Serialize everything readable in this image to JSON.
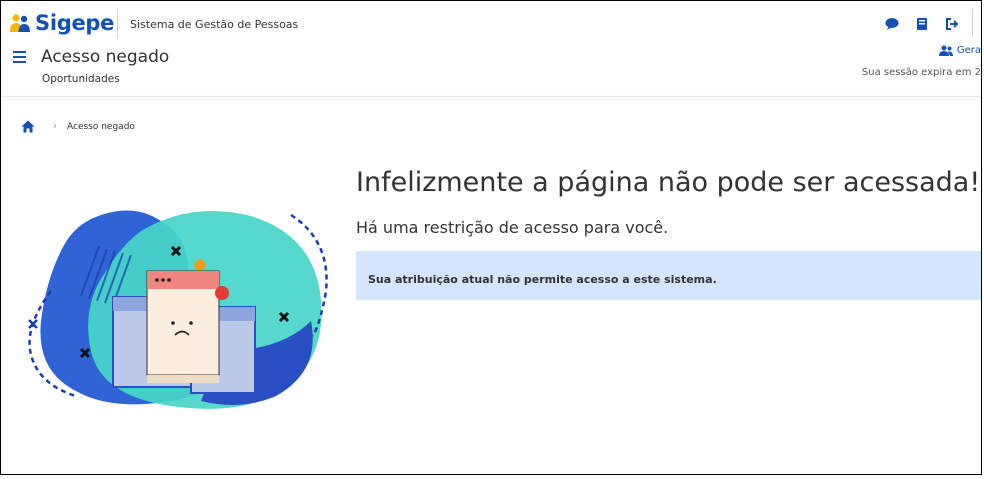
{
  "header": {
    "logo_text": "Sigepe",
    "system_name": "Sistema de Gestão de Pessoas",
    "icons": [
      "chat-icon",
      "book-icon",
      "logout-icon"
    ]
  },
  "title_bar": {
    "menu_icon": "hamburger-menu-icon",
    "title": "Acesso negado",
    "subtitle": "Oportunidades",
    "user_link": "Gera",
    "session_text": "Sua sessão expira em 2"
  },
  "breadcrumb": {
    "home_icon": "home-icon",
    "current": "Acesso negado"
  },
  "message": {
    "headline": "Infelizmente a página não pode ser acessada!",
    "subline": "Há uma restrição de acesso para você.",
    "alert": "Sua atribuição atual não permite acesso a este sistema."
  },
  "colors": {
    "brand_blue": "#1351b4",
    "alert_bg": "#d4e5ff",
    "logo_yellow": "#f7b600"
  }
}
